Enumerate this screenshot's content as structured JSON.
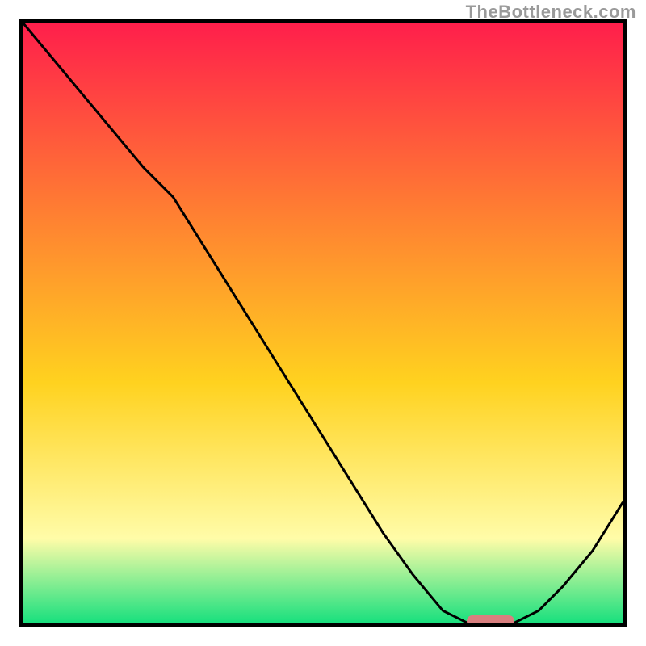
{
  "watermark": "TheBottleneck.com",
  "colors": {
    "top": "#ff1f4b",
    "upper": "#ff7a33",
    "mid": "#ffd21f",
    "lower": "#fffca8",
    "bottom": "#19e07e",
    "curve": "#000000",
    "marker": "#d97f7f",
    "border": "#000000"
  },
  "chart_data": {
    "type": "line",
    "title": "",
    "xlabel": "",
    "ylabel": "",
    "xlim": [
      0,
      100
    ],
    "ylim": [
      0,
      100
    ],
    "grid": false,
    "legend": false,
    "series": [
      {
        "name": "bottleneck-curve",
        "x": [
          0,
          5,
          10,
          15,
          20,
          25,
          30,
          35,
          40,
          45,
          50,
          55,
          60,
          65,
          70,
          74,
          78,
          82,
          86,
          90,
          95,
          100
        ],
        "values": [
          100,
          94,
          88,
          82,
          76,
          71,
          63,
          55,
          47,
          39,
          31,
          23,
          15,
          8,
          2,
          0,
          0,
          0,
          2,
          6,
          12,
          20
        ]
      }
    ],
    "annotations": [
      {
        "name": "optimal-marker",
        "kind": "bar",
        "x_start": 74,
        "x_end": 82,
        "y": 0,
        "color": "#d97f7f"
      }
    ]
  }
}
